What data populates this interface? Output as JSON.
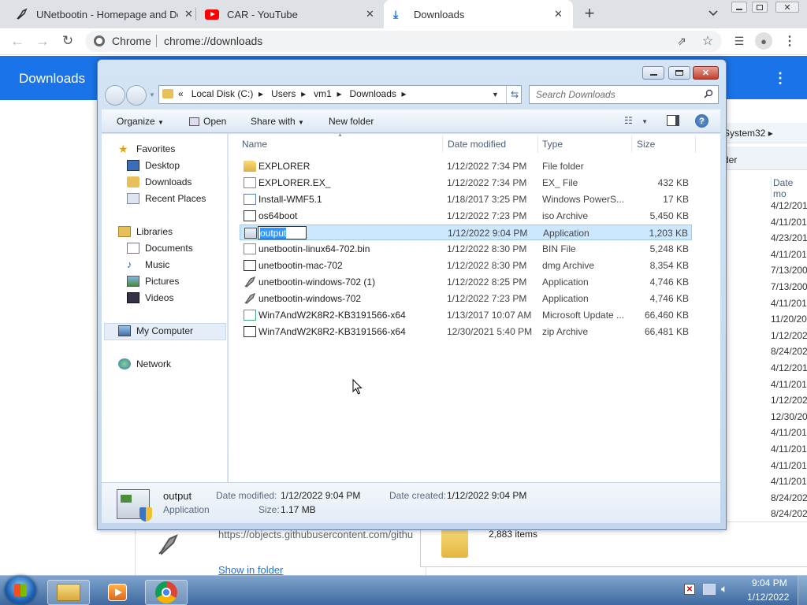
{
  "browser": {
    "tabs": [
      {
        "title": "UNetbootin - Homepage and Do",
        "icon": "unetbootin-icon"
      },
      {
        "title": "CAR - YouTube",
        "icon": "youtube-icon"
      },
      {
        "title": "Downloads",
        "icon": "download-icon"
      }
    ],
    "new_tab": "+",
    "omnibox": {
      "site_label": "Chrome",
      "url": "chrome://downloads"
    }
  },
  "downloads_page": {
    "title": "Downloads",
    "url_text": "https://objects.githubusercontent.com/githu",
    "show_in_folder": "Show in folder"
  },
  "background_explorer": {
    "crumb": "System32",
    "folder_btn": "der",
    "col_header": "Date mo",
    "dates": [
      "4/12/201",
      "4/11/201",
      "4/23/201",
      "4/11/201",
      "7/13/200",
      "7/13/200",
      "4/11/201",
      "11/20/20",
      "1/12/202",
      "8/24/202",
      "4/12/201",
      "4/11/201",
      "1/12/202",
      "12/30/20",
      "4/11/201",
      "4/11/201",
      "4/11/201",
      "4/11/201",
      "8/24/202",
      "8/24/202"
    ],
    "items_count": "2,883 items"
  },
  "explorer": {
    "address": [
      "«",
      "Local Disk (C:)",
      "Users",
      "vm1",
      "Downloads"
    ],
    "search_placeholder": "Search Downloads",
    "toolbar": {
      "organize": "Organize",
      "open": "Open",
      "share_with": "Share with",
      "new_folder": "New folder"
    },
    "nav": {
      "favorites": "Favorites",
      "fav_items": [
        "Desktop",
        "Downloads",
        "Recent Places"
      ],
      "libraries": "Libraries",
      "lib_items": [
        "Documents",
        "Music",
        "Pictures",
        "Videos"
      ],
      "computer": "My Computer",
      "network": "Network"
    },
    "columns": {
      "name": "Name",
      "date": "Date modified",
      "type": "Type",
      "size": "Size"
    },
    "files": [
      {
        "name": "EXPLORER",
        "date": "1/12/2022 7:34 PM",
        "type": "File folder",
        "size": "",
        "icon": "folder-icon"
      },
      {
        "name": "EXPLORER.EX_",
        "date": "1/12/2022 7:34 PM",
        "type": "EX_ File",
        "size": "432 KB",
        "icon": "file-icon"
      },
      {
        "name": "Install-WMF5.1",
        "date": "1/18/2017 3:25 PM",
        "type": "Windows PowerS...",
        "size": "17 KB",
        "icon": "script-icon"
      },
      {
        "name": "os64boot",
        "date": "1/12/2022 7:23 PM",
        "type": "iso Archive",
        "size": "5,450 KB",
        "icon": "iso-icon"
      },
      {
        "name": "output",
        "date": "1/12/2022 9:04 PM",
        "type": "Application",
        "size": "1,203 KB",
        "icon": "app-icon"
      },
      {
        "name": "unetbootin-linux64-702.bin",
        "date": "1/12/2022 8:30 PM",
        "type": "BIN File",
        "size": "5,248 KB",
        "icon": "file-icon"
      },
      {
        "name": "unetbootin-mac-702",
        "date": "1/12/2022 8:30 PM",
        "type": "dmg Archive",
        "size": "8,354 KB",
        "icon": "dmg-icon"
      },
      {
        "name": "unetbootin-windows-702 (1)",
        "date": "1/12/2022 8:25 PM",
        "type": "Application",
        "size": "4,746 KB",
        "icon": "unetbootin-icon"
      },
      {
        "name": "unetbootin-windows-702",
        "date": "1/12/2022 7:23 PM",
        "type": "Application",
        "size": "4,746 KB",
        "icon": "unetbootin-icon"
      },
      {
        "name": "Win7AndW2K8R2-KB3191566-x64",
        "date": "1/13/2017 10:07 AM",
        "type": "Microsoft Update ...",
        "size": "66,460 KB",
        "icon": "msu-icon"
      },
      {
        "name": "Win7AndW2K8R2-KB3191566-x64",
        "date": "12/30/2021 5:40 PM",
        "type": "zip Archive",
        "size": "66,481 KB",
        "icon": "zip-icon"
      }
    ],
    "selected_index": 4,
    "rename_value": "output",
    "details": {
      "name": "output",
      "kind": "Application",
      "date_modified_label": "Date modified:",
      "date_modified": "1/12/2022 9:04 PM",
      "date_created_label": "Date created:",
      "date_created": "1/12/2022 9:04 PM",
      "size_label": "Size:",
      "size": "1.17 MB"
    }
  },
  "taskbar": {
    "time": "9:04 PM",
    "date": "1/12/2022"
  },
  "colors": {
    "chrome_blue": "#1a73e8",
    "selection": "#cce8ff",
    "win7_frame": "#c8dcf0",
    "taskbar": "#4f7db2"
  }
}
